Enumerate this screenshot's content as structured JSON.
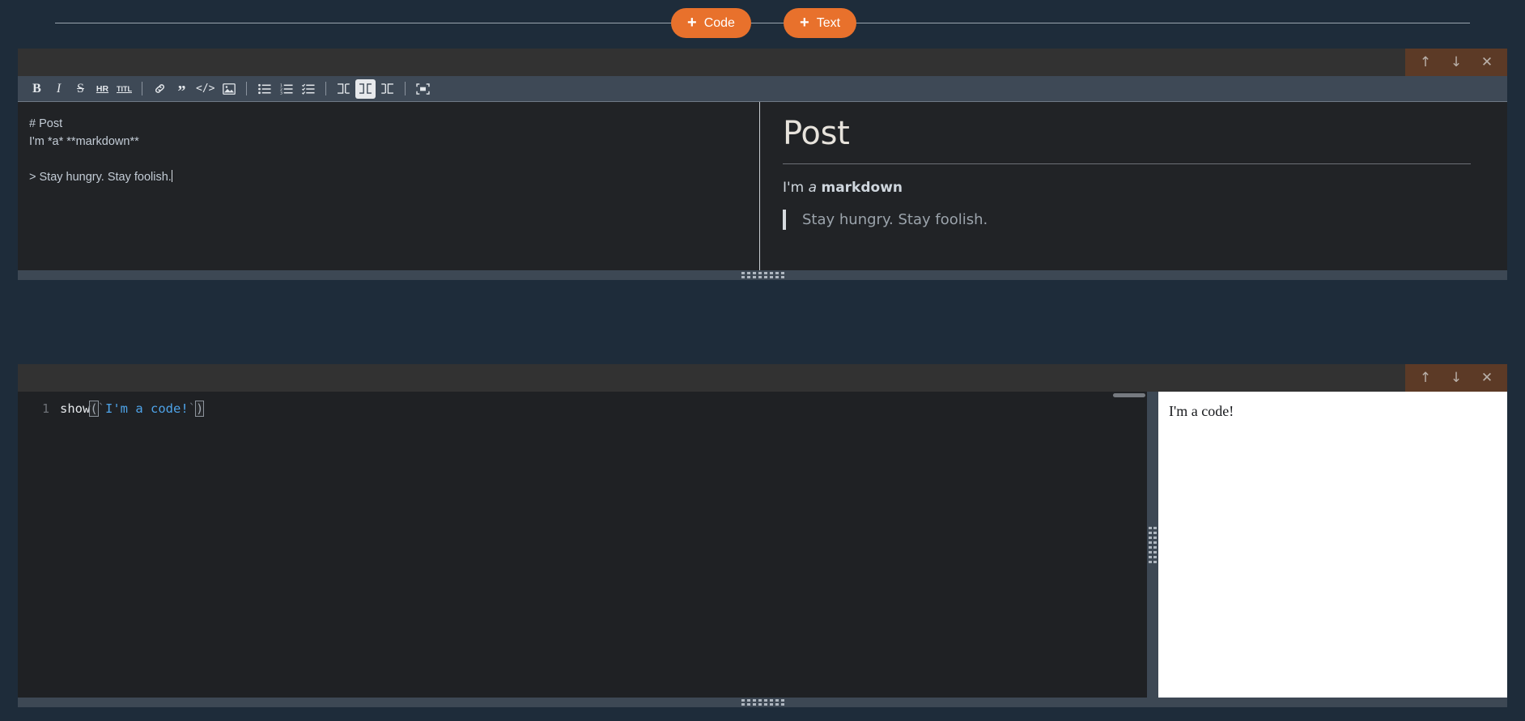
{
  "add_bar": {
    "code_button": {
      "label": "Code",
      "icon": "plus-icon",
      "glyph": "+"
    },
    "text_button": {
      "label": "Text",
      "icon": "plus-icon",
      "glyph": "+"
    }
  },
  "accent_colors": {
    "add_button": "#e8712c",
    "cell_actions_bg": "#5c3a26",
    "toolbar_bg": "#3e4956",
    "page_bg": "#1e2c3a",
    "cell_bg": "#212326",
    "cell_header_bg": "#323232",
    "output_bg": "#ffffff",
    "string_token": "#4ea3e8"
  },
  "cell_actions": {
    "move_up": {
      "name": "move-cell-up",
      "glyph": "↑"
    },
    "move_down": {
      "name": "move-cell-down",
      "glyph": "↓"
    },
    "close": {
      "name": "delete-cell",
      "glyph": "✕"
    }
  },
  "markdown_cell": {
    "toolbar": [
      {
        "name": "bold",
        "label": "B",
        "type": "text",
        "active": false
      },
      {
        "name": "italic",
        "label": "I",
        "type": "text",
        "active": false
      },
      {
        "name": "strikethrough",
        "label": "S",
        "type": "text",
        "active": false
      },
      {
        "name": "horizontal-rule",
        "label": "HR",
        "type": "text",
        "active": false
      },
      {
        "name": "title",
        "label": "TITL",
        "type": "text",
        "active": false
      },
      {
        "name": "separator-1",
        "label": "",
        "type": "sep",
        "active": false
      },
      {
        "name": "link",
        "label": "",
        "type": "icon",
        "active": false
      },
      {
        "name": "quote",
        "label": "”",
        "type": "text",
        "active": false
      },
      {
        "name": "code",
        "label": "</>",
        "type": "text",
        "active": false
      },
      {
        "name": "image",
        "label": "",
        "type": "icon",
        "active": false
      },
      {
        "name": "separator-2",
        "label": "",
        "type": "sep",
        "active": false
      },
      {
        "name": "bullet-list",
        "label": "",
        "type": "icon",
        "active": false
      },
      {
        "name": "ordered-list",
        "label": "",
        "type": "icon",
        "active": false
      },
      {
        "name": "check-list",
        "label": "",
        "type": "icon",
        "active": false
      },
      {
        "name": "separator-3",
        "label": "",
        "type": "sep",
        "active": false
      },
      {
        "name": "layout-editor-only",
        "label": "",
        "type": "icon",
        "active": false
      },
      {
        "name": "layout-split",
        "label": "",
        "type": "icon",
        "active": true
      },
      {
        "name": "layout-preview-only",
        "label": "",
        "type": "icon",
        "active": false
      },
      {
        "name": "separator-4",
        "label": "",
        "type": "sep",
        "active": false
      },
      {
        "name": "fullscreen",
        "label": "",
        "type": "icon",
        "active": false
      }
    ],
    "source": "# Post\nI'm *a* **markdown**\n\n> Stay hungry. Stay foolish.",
    "preview": {
      "heading": "Post",
      "paragraph_prefix": "I'm ",
      "paragraph_italic": "a",
      "paragraph_space": " ",
      "paragraph_bold": "markdown",
      "blockquote": "Stay hungry. Stay foolish."
    }
  },
  "code_cell": {
    "line_numbers": [
      "1"
    ],
    "code_tokens": {
      "fn": "show",
      "open_paren": "(",
      "backtick_open": "`",
      "string": "I'm a code!",
      "backtick_close": "`",
      "close_paren": ")"
    },
    "full_code": "show(`I'm a code!`)",
    "output": "I'm a code!"
  },
  "resize_grips": {
    "markdown_bottom": "resize-markdown-cell",
    "code_bottom": "resize-code-cell",
    "code_output_split": "resize-code-output-split"
  }
}
